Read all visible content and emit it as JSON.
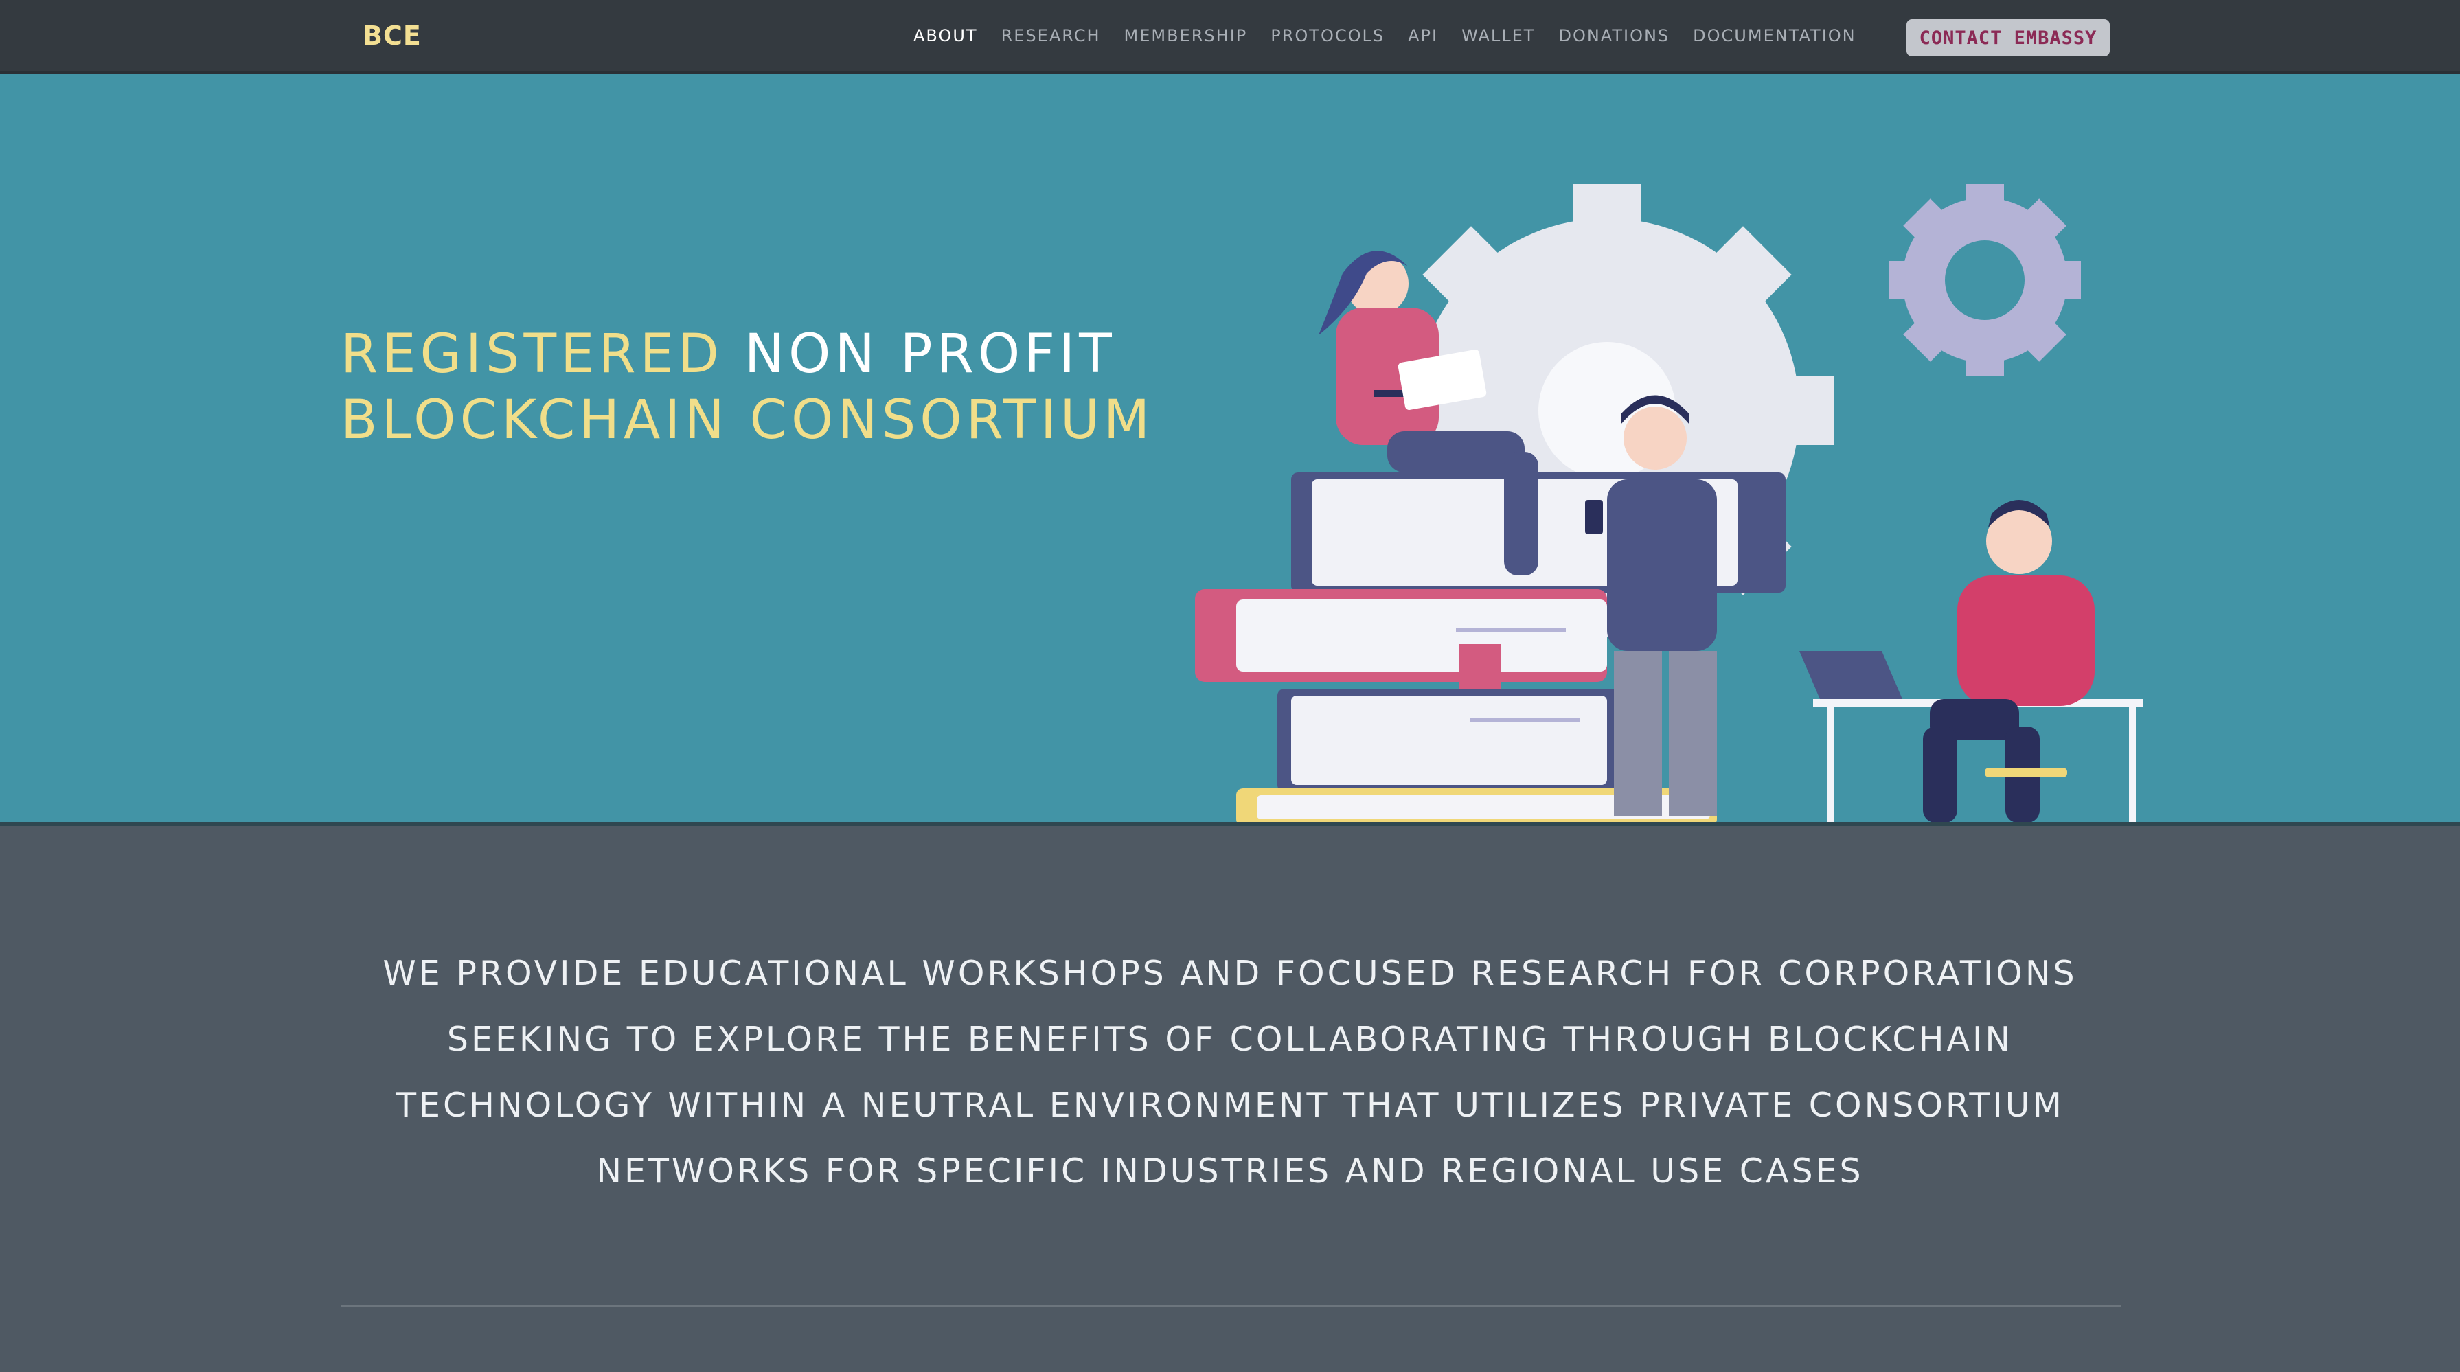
{
  "brand": "BCE",
  "nav": {
    "items": [
      {
        "label": "ABOUT",
        "active": true
      },
      {
        "label": "RESEARCH",
        "active": false
      },
      {
        "label": "MEMBERSHIP",
        "active": false
      },
      {
        "label": "PROTOCOLS",
        "active": false
      },
      {
        "label": "API",
        "active": false
      },
      {
        "label": "WALLET",
        "active": false
      },
      {
        "label": "DONATIONS",
        "active": false
      },
      {
        "label": "DOCUMENTATION",
        "active": false
      }
    ],
    "contact_label": "CONTACT EMBASSY"
  },
  "hero": {
    "title_part1": "REGISTERED ",
    "title_part2": "NON PROFIT",
    "title_part3": "BLOCKCHAIN CONSORTIUM",
    "illustration": "team-working-with-gears-and-books-illustration"
  },
  "mission": {
    "text": "WE PROVIDE EDUCATIONAL WORKSHOPS AND FOCUSED RESEARCH FOR CORPORATIONS SEEKING TO EXPLORE THE BENEFITS OF COLLABORATING THROUGH BLOCKCHAIN TECHNOLOGY WITHIN A NEUTRAL ENVIRONMENT THAT UTILIZES PRIVATE CONSORTIUM NETWORKS FOR SPECIFIC INDUSTRIES AND REGIONAL USE CASES"
  },
  "colors": {
    "navbar": "#343a40",
    "hero_bg": "#4294a6",
    "body_bg": "#4f5963",
    "brand_yellow": "#f0de8a",
    "contact_text": "#8b2a55"
  }
}
